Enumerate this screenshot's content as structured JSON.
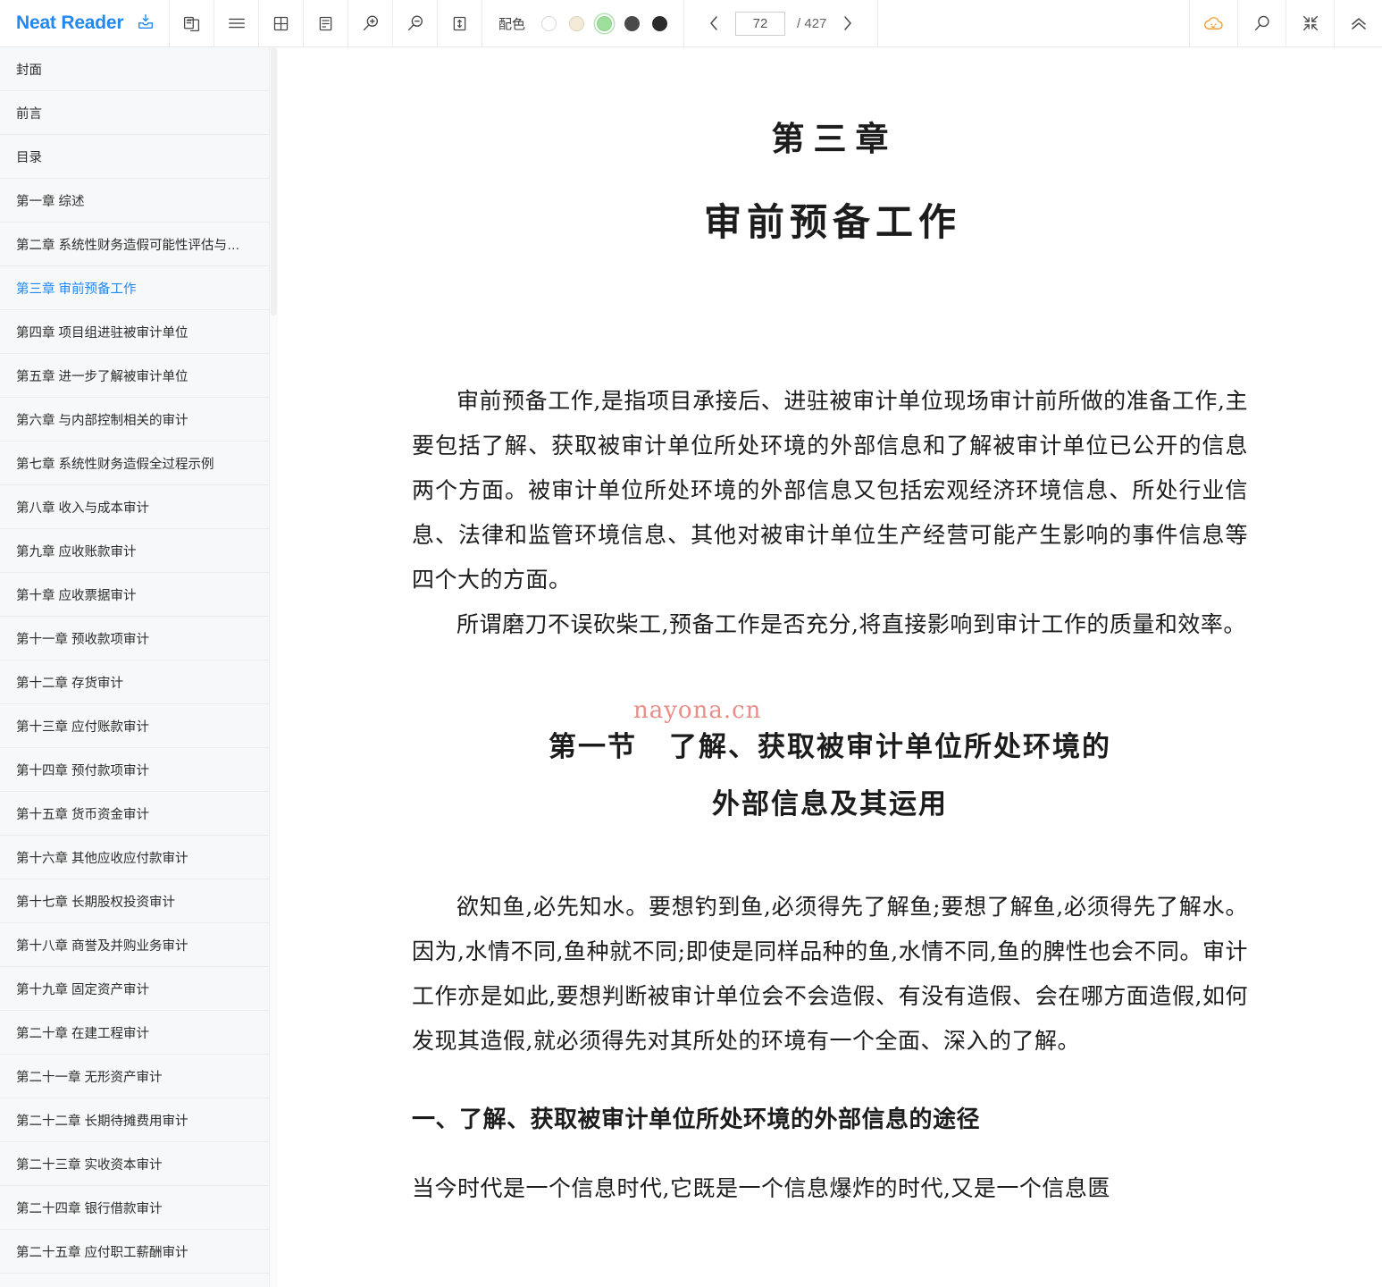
{
  "app": {
    "brand": "Neat Reader",
    "brand_color": "#2288ee",
    "save_icon": "download-inbox-icon"
  },
  "toolbar": {
    "icons": [
      {
        "name": "two-page-view-icon",
        "title": "two-page"
      },
      {
        "name": "hamburger-menu-icon",
        "title": "menu"
      },
      {
        "name": "grid-view-icon",
        "title": "grid"
      },
      {
        "name": "text-layout-icon",
        "title": "layout"
      },
      {
        "name": "zoom-in-icon",
        "title": "zoom in"
      },
      {
        "name": "zoom-out-icon",
        "title": "zoom out"
      },
      {
        "name": "line-height-icon",
        "title": "line height"
      }
    ],
    "color_scheme": {
      "label": "配色",
      "swatches": [
        {
          "name": "white",
          "hex": "#ffffff",
          "selected": false
        },
        {
          "name": "sepia",
          "hex": "#f4ead8",
          "selected": false
        },
        {
          "name": "green",
          "hex": "#9ede9b",
          "selected": true
        },
        {
          "name": "dark-gray",
          "hex": "#4a4a4a",
          "selected": false
        },
        {
          "name": "black",
          "hex": "#2b2b2b",
          "selected": false
        }
      ]
    },
    "pager": {
      "prev": "‹",
      "next": "›",
      "current_page": "72",
      "total_label": "/ 427"
    },
    "right_icons": [
      {
        "name": "cloud-sync-icon",
        "color": "#f0a030"
      },
      {
        "name": "search-icon",
        "color": "#4a4a4a"
      },
      {
        "name": "collapse-fullscreen-icon",
        "color": "#4a4a4a"
      },
      {
        "name": "chevron-double-up-icon",
        "color": "#4a4a4a"
      }
    ]
  },
  "sidebar": {
    "items": [
      {
        "label": "封面",
        "active": false
      },
      {
        "label": "前言",
        "active": false
      },
      {
        "label": "目录",
        "active": false
      },
      {
        "label": "第一章 综述",
        "active": false
      },
      {
        "label": "第二章 系统性财务造假可能性评估与…",
        "active": false
      },
      {
        "label": "第三章 审前预备工作",
        "active": true
      },
      {
        "label": "第四章 项目组进驻被审计单位",
        "active": false
      },
      {
        "label": "第五章 进一步了解被审计单位",
        "active": false
      },
      {
        "label": "第六章 与内部控制相关的审计",
        "active": false
      },
      {
        "label": "第七章 系统性财务造假全过程示例",
        "active": false
      },
      {
        "label": "第八章 收入与成本审计",
        "active": false
      },
      {
        "label": "第九章 应收账款审计",
        "active": false
      },
      {
        "label": "第十章 应收票据审计",
        "active": false
      },
      {
        "label": "第十一章 预收款项审计",
        "active": false
      },
      {
        "label": "第十二章 存货审计",
        "active": false
      },
      {
        "label": "第十三章 应付账款审计",
        "active": false
      },
      {
        "label": "第十四章 预付款项审计",
        "active": false
      },
      {
        "label": "第十五章 货币资金审计",
        "active": false
      },
      {
        "label": "第十六章 其他应收应付款审计",
        "active": false
      },
      {
        "label": "第十七章 长期股权投资审计",
        "active": false
      },
      {
        "label": "第十八章 商誉及并购业务审计",
        "active": false
      },
      {
        "label": "第十九章 固定资产审计",
        "active": false
      },
      {
        "label": "第二十章 在建工程审计",
        "active": false
      },
      {
        "label": "第二十一章 无形资产审计",
        "active": false
      },
      {
        "label": "第二十二章 长期待摊费用审计",
        "active": false
      },
      {
        "label": "第二十三章 实收资本审计",
        "active": false
      },
      {
        "label": "第二十四章 银行借款审计",
        "active": false
      },
      {
        "label": "第二十五章 应付职工薪酬审计",
        "active": false
      }
    ]
  },
  "document": {
    "chapter_number": "第三章",
    "chapter_title": "审前预备工作",
    "paragraph_1": "审前预备工作,是指项目承接后、进驻被审计单位现场审计前所做的准备工作,主要包括了解、获取被审计单位所处环境的外部信息和了解被审计单位已公开的信息两个方面。被审计单位所处环境的外部信息又包括宏观经济环境信息、所处行业信息、法律和监管环境信息、其他对被审计单位生产经营可能产生影响的事件信息等四个大的方面。",
    "paragraph_2": "所谓磨刀不误砍柴工,预备工作是否充分,将直接影响到审计工作的质量和效率。",
    "watermark": "nayona.cn",
    "section_number": "第一节",
    "section_title_line1": "了解、获取被审计单位所处环境的",
    "section_title_line2": "外部信息及其运用",
    "paragraph_3": "欲知鱼,必先知水。要想钓到鱼,必须得先了解鱼;要想了解鱼,必须得先了解水。因为,水情不同,鱼种就不同;即使是同样品种的鱼,水情不同,鱼的脾性也会不同。审计工作亦是如此,要想判断被审计单位会不会造假、有没有造假、会在哪方面造假,如何发现其造假,就必须得先对其所处的环境有一个全面、深入的了解。",
    "subsection_title": "一、了解、获取被审计单位所处环境的外部信息的途径",
    "paragraph_4": "当今时代是一个信息时代,它既是一个信息爆炸的时代,又是一个信息匮"
  }
}
